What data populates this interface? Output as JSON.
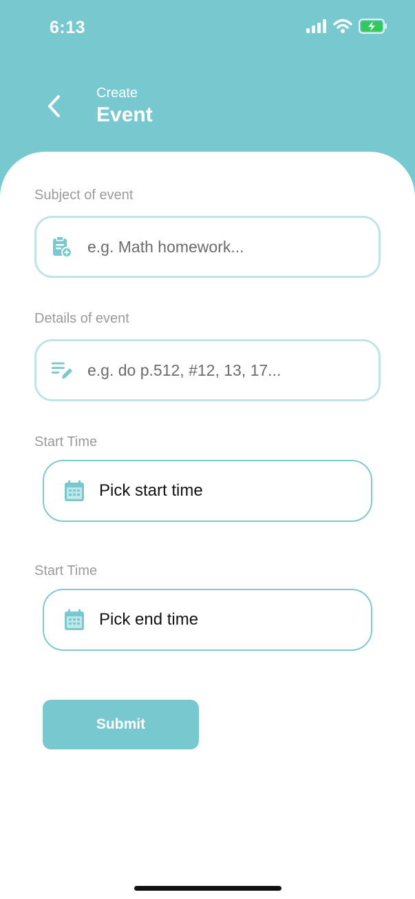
{
  "status": {
    "time": "6:13"
  },
  "header": {
    "subtitle": "Create",
    "title": "Event"
  },
  "form": {
    "subject": {
      "label": "Subject of event",
      "placeholder": "e.g. Math homework..."
    },
    "details": {
      "label": "Details of event",
      "placeholder": "e.g. do p.512, #12, 13, 17..."
    },
    "start": {
      "label": "Start Time",
      "value": "Pick start time"
    },
    "end": {
      "label": "Start Time",
      "value": "Pick end time"
    },
    "submit_label": "Submit"
  },
  "icons": {
    "back": "chevron-left-icon",
    "subject": "clipboard-add-icon",
    "details": "notes-edit-icon",
    "calendar": "calendar-icon",
    "signal": "signal-icon",
    "wifi": "wifi-icon",
    "battery": "battery-charging-icon"
  },
  "colors": {
    "accent": "#78c9cf",
    "field_border": "#bfe3e8",
    "battery": "#34c759"
  }
}
